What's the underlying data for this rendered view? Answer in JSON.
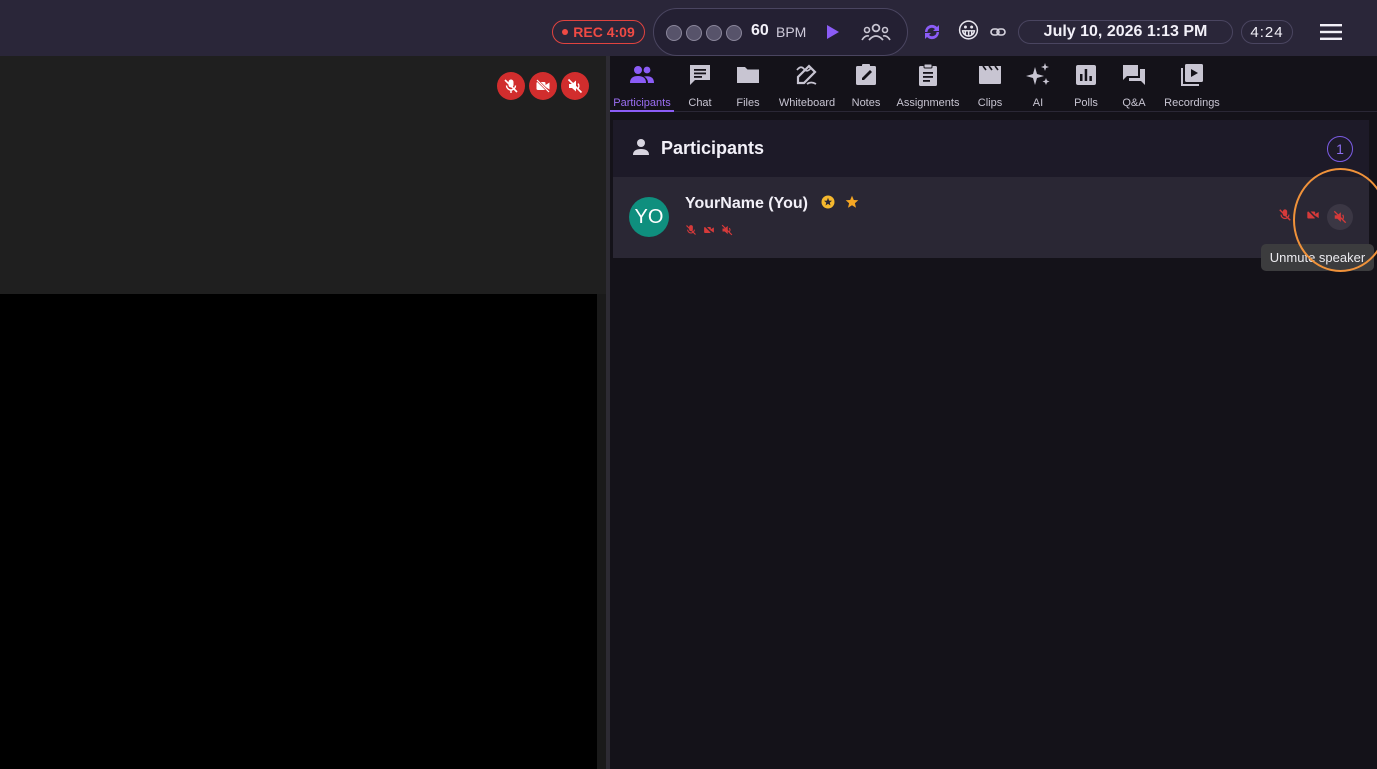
{
  "topbar": {
    "rec_label": "REC 4:09",
    "bpm_value": "60",
    "bpm_unit": "BPM",
    "emoji": "😀",
    "datetime": "July 10, 2026 1:13 PM",
    "timer": "4:24"
  },
  "tabs": [
    {
      "label": "Participants",
      "icon": "people-icon"
    },
    {
      "label": "Chat",
      "icon": "chat-icon"
    },
    {
      "label": "Files",
      "icon": "folder-icon"
    },
    {
      "label": "Whiteboard",
      "icon": "draw-icon"
    },
    {
      "label": "Notes",
      "icon": "notes-icon"
    },
    {
      "label": "Assignments",
      "icon": "clipboard-icon"
    },
    {
      "label": "Clips",
      "icon": "clapper-icon"
    },
    {
      "label": "AI",
      "icon": "sparkle-icon"
    },
    {
      "label": "Polls",
      "icon": "poll-icon"
    },
    {
      "label": "Q&A",
      "icon": "forum-icon"
    },
    {
      "label": "Recordings",
      "icon": "video-library-icon"
    }
  ],
  "active_tab": "Participants",
  "participants": {
    "title": "Participants",
    "count": "1",
    "items": [
      {
        "avatar": "YO",
        "name": "YourName (You)",
        "avatar_color": "#0f8f7e"
      }
    ]
  },
  "tooltip": "Unmute speaker",
  "colors": {
    "accent": "#8b5cf6",
    "danger": "#d12d2d",
    "highlight": "#f0923a"
  }
}
